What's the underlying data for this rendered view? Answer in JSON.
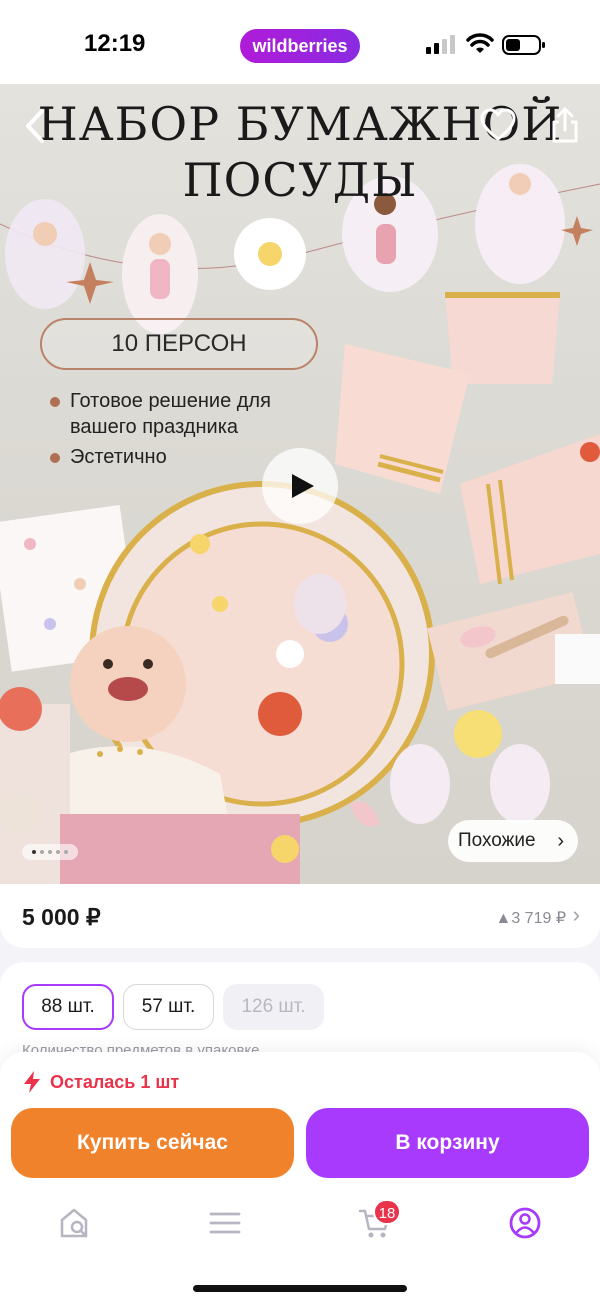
{
  "status_bar": {
    "time": "12:19",
    "brand": "wildberries"
  },
  "hero": {
    "title_line1": "НАБОР БУМАЖНОЙ",
    "title_line2": "ПОСУДЫ",
    "persons": "10 ПЕРСОН",
    "bullets": [
      "Готовое решение для вашего праздника",
      "Эстетично"
    ],
    "similar_label": "Похожие",
    "similar_chevron": "›",
    "image_count": 5,
    "active_image": 1
  },
  "price": {
    "current": "5 000 ₽",
    "history": "▲3 719 ₽",
    "chevron": "›"
  },
  "quantity": {
    "options": [
      "88 шт.",
      "57 шт.",
      "126 шт."
    ],
    "selected": "88 шт.",
    "caption": "Количество предметов в упаковке"
  },
  "purchase": {
    "stock_alert": "Осталась 1 шт",
    "buy_now": "Купить сейчас",
    "add_to_cart": "В корзину"
  },
  "tab_bar": {
    "items": [
      "home-search-icon",
      "menu-icon",
      "cart-icon",
      "profile-icon"
    ],
    "active": "profile-icon",
    "cart_badge": "18"
  },
  "colors": {
    "accent": "#a73afd",
    "buy_now": "#f0822c",
    "alert": "#e8334a"
  }
}
